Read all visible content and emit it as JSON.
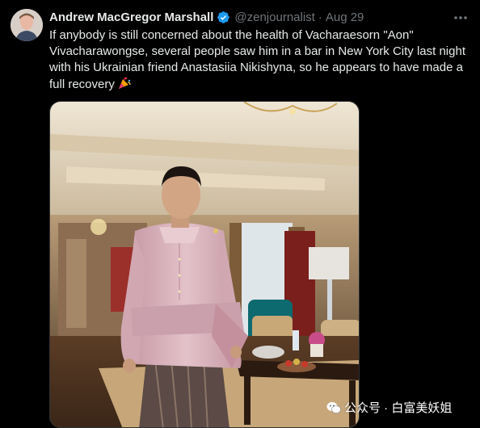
{
  "tweet": {
    "author_name": "Andrew MacGregor Marshall",
    "handle": "@zenjournalist",
    "separator": "·",
    "date": "Aug 29",
    "text": "If anybody is still concerned about the health of Vacharaesorn \"Aon\" Vivacharawongse, several people saw him in a bar in New York City last night with his Ukrainian friend Anastasiia Nikishyna, so he appears to have made a full recovery",
    "emoji": "party-popper-icon"
  },
  "watermark": {
    "text": "公众号 · 白富美妖姐"
  },
  "colors": {
    "background": "#000000",
    "text": "#e7e9ea",
    "secondary": "#71767b",
    "verified": "#1d9bf0",
    "jacket": "#d9b3bd"
  }
}
